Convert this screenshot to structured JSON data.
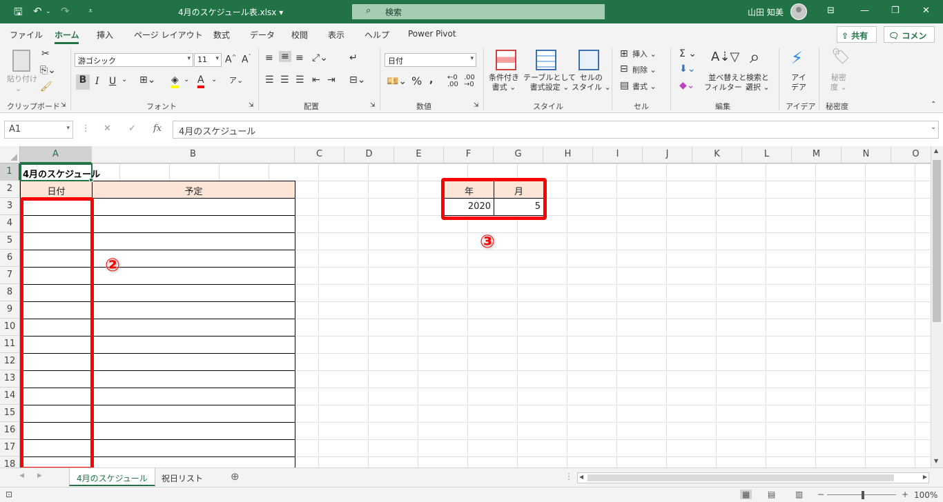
{
  "titlebar": {
    "filename": "4月のスケジュール表.xlsx ▾",
    "search_label": "検索",
    "username": "山田 知美"
  },
  "menu": {
    "tabs": [
      "ファイル",
      "ホーム",
      "挿入",
      "ページ レイアウト",
      "数式",
      "データ",
      "校閲",
      "表示",
      "ヘルプ",
      "Power Pivot"
    ],
    "share": "共有",
    "comment": "コメント"
  },
  "ribbon": {
    "clipboard": {
      "paste": "貼り付け",
      "label": "クリップボード"
    },
    "font": {
      "name": "游ゴシック",
      "size": "11",
      "label": "フォント"
    },
    "alignment": {
      "label": "配置"
    },
    "number": {
      "format": "日付",
      "label": "数値"
    },
    "styles": {
      "conditional": [
        "条件付き",
        "書式 ⌄"
      ],
      "table": [
        "テーブルとして",
        "書式設定 ⌄"
      ],
      "cell": [
        "セルの",
        "スタイル ⌄"
      ],
      "label": "スタイル"
    },
    "cells": {
      "insert": "挿入",
      "delete": "削除",
      "format": "書式",
      "label": "セル"
    },
    "editing": {
      "sort": [
        "並べ替えと",
        "フィルター ⌄"
      ],
      "find": [
        "検索と",
        "選択 ⌄"
      ],
      "label": "編集"
    },
    "ideas": {
      "text": [
        "アイ",
        "デア"
      ],
      "label": "アイデア"
    },
    "sensitivity": {
      "text": [
        "秘密",
        "度 ⌄"
      ],
      "label": "秘密度"
    }
  },
  "formula": {
    "namebox": "A1",
    "content": "4月のスケジュール"
  },
  "columns": [
    "A",
    "B",
    "C",
    "D",
    "E",
    "F",
    "G",
    "H",
    "I",
    "J",
    "K",
    "L",
    "M",
    "N",
    "O"
  ],
  "rows": [
    "1",
    "2",
    "3",
    "4",
    "5",
    "6",
    "7",
    "8",
    "9",
    "10",
    "11",
    "12",
    "13",
    "14",
    "15",
    "16",
    "17",
    "18"
  ],
  "sheet": {
    "title": "4月のスケジュール",
    "header_date": "日付",
    "header_plan": "予定",
    "header_year": "年",
    "header_month": "月",
    "year_value": "2020",
    "month_value": "5",
    "marker2": "②",
    "marker3": "③"
  },
  "sheettabs": [
    "4月のスケジュール",
    "祝日リスト"
  ],
  "status": {
    "zoom": "100%"
  },
  "colors": {
    "accent": "#217346",
    "highlight": "#ff0000",
    "header_fill": "#fce4d6"
  }
}
